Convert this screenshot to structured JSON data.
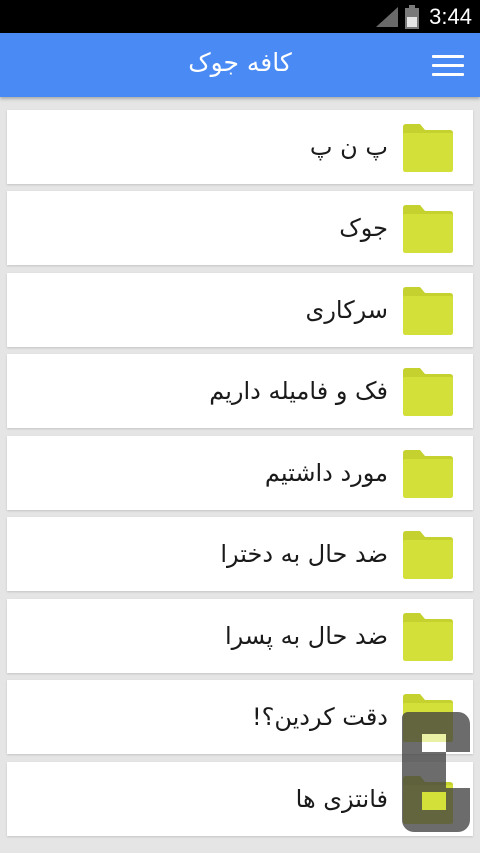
{
  "status_bar": {
    "time": "3:44",
    "icons": [
      "signal-icon",
      "battery-icon"
    ]
  },
  "app_bar": {
    "title": "کافه جوک",
    "menu_icon": "hamburger-menu-icon",
    "color": "#4a8af4"
  },
  "categories": [
    {
      "label": "پ ن پ",
      "icon": "folder-icon"
    },
    {
      "label": "جوک",
      "icon": "folder-icon"
    },
    {
      "label": "سرکاری",
      "icon": "folder-icon"
    },
    {
      "label": "فک و فامیله داریم",
      "icon": "folder-icon"
    },
    {
      "label": "مورد داشتیم",
      "icon": "folder-icon"
    },
    {
      "label": "ضد حال به دخترا",
      "icon": "folder-icon"
    },
    {
      "label": "ضد حال به پسرا",
      "icon": "folder-icon"
    },
    {
      "label": "دقت کردین؟!",
      "icon": "folder-icon"
    },
    {
      "label": "فانتزی ها",
      "icon": "folder-icon"
    }
  ],
  "colors": {
    "folder": "#d4e03a",
    "folder_tab": "#c5d12f",
    "background": "#e5e5e5"
  },
  "watermark_icon": "cafebazaar-logo-icon"
}
